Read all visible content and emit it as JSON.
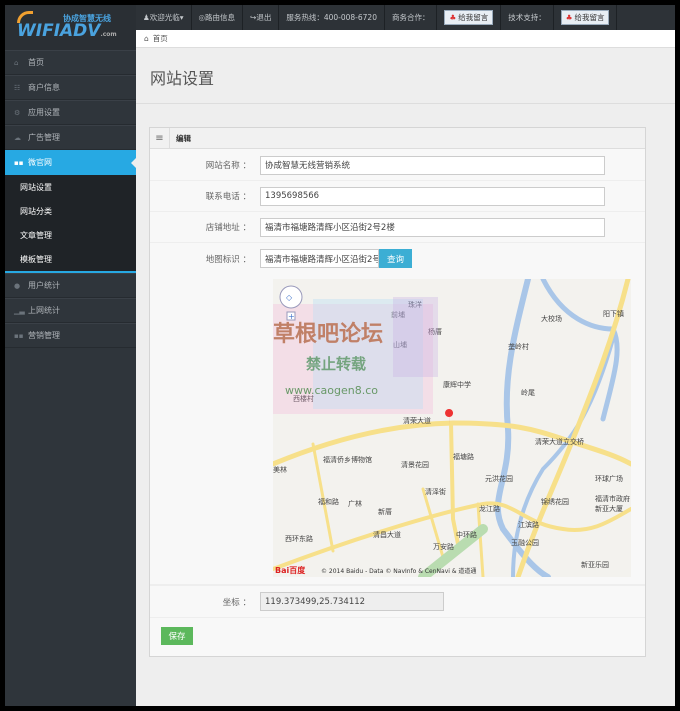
{
  "logo": {
    "brand": "WIFIADV",
    "suffix": ".com",
    "tagline": "协成智慧无线"
  },
  "sidebar": {
    "items": [
      {
        "label": "首页",
        "icon": "home"
      },
      {
        "label": "商户信息",
        "icon": "users"
      },
      {
        "label": "应用设置",
        "icon": "cogs"
      },
      {
        "label": "广告管理",
        "icon": "cloud"
      },
      {
        "label": "微官网",
        "icon": "th"
      }
    ],
    "sub_items": [
      "网站设置",
      "网站分类",
      "文章管理",
      "模板管理"
    ],
    "items_after": [
      {
        "label": "用户统计",
        "icon": "user"
      },
      {
        "label": "上网统计",
        "icon": "signal"
      },
      {
        "label": "营销管理",
        "icon": "th"
      }
    ]
  },
  "topbar": {
    "welcome": "欢迎光临",
    "router": "路由信息",
    "logout": "退出",
    "hotline": "服务热线：400-008-6720",
    "business": "商务合作：",
    "qq1": "给我留言",
    "tech": "技术支持：",
    "qq2": "给我留言"
  },
  "breadcrumb": "首页",
  "page_title": "网站设置",
  "panel": {
    "title": "编辑",
    "fields": {
      "site_name": {
        "label": "网站名称 ：",
        "value": "协成智慧无线营销系统"
      },
      "phone": {
        "label": "联系电话 ：",
        "value": "1395698566"
      },
      "address": {
        "label": "店铺地址 ：",
        "value": "福清市福塘路清辉小区沿街2号2楼"
      },
      "map_mark": {
        "label": "地图标识 ：",
        "value": "福清市福塘路清辉小区沿街2号",
        "button": "查询"
      },
      "coords": {
        "label": "坐标 ：",
        "value": "119.373499,25.734112"
      }
    },
    "save": "保存"
  },
  "map": {
    "labels": [
      "珠洋",
      "前埔",
      "杨厝",
      "山埔",
      "康辉中学",
      "大校场",
      "垄岭村",
      "岭尾",
      "阳下镇",
      "清荣大道",
      "清荣大道立交桥",
      "福清侨乡博物馆",
      "清景花园",
      "元洪花园",
      "环球广场",
      "福清市政府",
      "锦绣花园",
      "新亚大厦",
      "广林",
      "新厝",
      "清昌大道",
      "龙江路",
      "江滨路",
      "玉融公园",
      "新亚乐园",
      "福塘路",
      "福和路",
      "西环东路",
      "万安路",
      "中环路",
      "清泽街",
      "美林",
      "西楼村"
    ],
    "copyright": "© 2014 Baidu - Data © NavInfo & CenNavi & 道道通",
    "baidu": "Bai百度",
    "watermark": [
      "草根吧论坛",
      "禁止转载",
      "www.caogen8.co"
    ]
  }
}
